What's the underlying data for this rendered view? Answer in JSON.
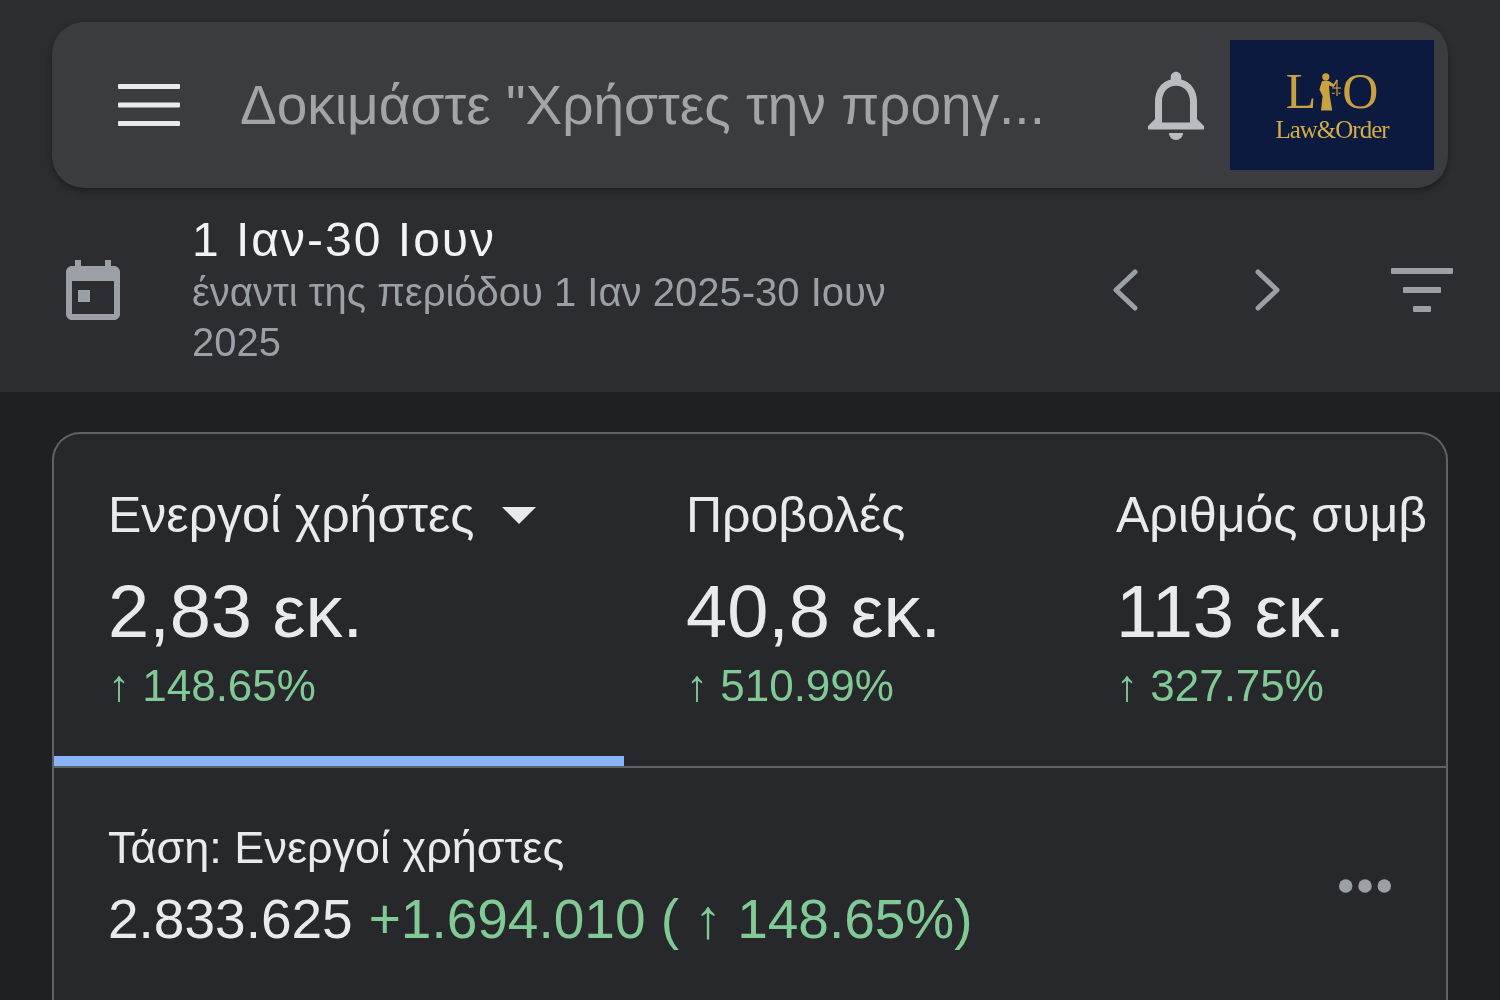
{
  "search_bar": {
    "placeholder": "Δοκιμάστε \"Χρήστες την προηγ...",
    "logo": {
      "monogram": [
        "L",
        "O"
      ],
      "wordmark": "Law&Order"
    }
  },
  "date_range": {
    "title": "1 Ιαν-30 Ιουν",
    "comparison": "έναντι της περιόδου 1 Ιαν 2025-30 Ιουν 2025"
  },
  "metrics": [
    {
      "label": "Ενεργοί χρήστες",
      "dropdown": true,
      "value": "2,83 εκ.",
      "change": "↑ 148.65%",
      "selected": true
    },
    {
      "label": "Προβολές",
      "dropdown": false,
      "value": "40,8 εκ.",
      "change": "↑ 510.99%",
      "selected": false
    },
    {
      "label": "Αριθμός συμβ",
      "dropdown": false,
      "value": "113 εκ.",
      "change": "↑ 327.75%",
      "selected": false
    }
  ],
  "trend": {
    "title": "Τάση: Ενεργοί χρήστες",
    "total": "2.833.625",
    "delta": "+1.694.010 ( ↑ 148.65%)"
  }
}
